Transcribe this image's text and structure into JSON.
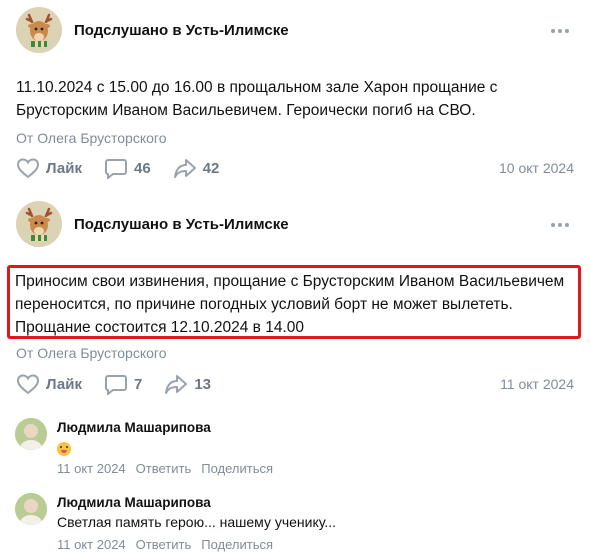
{
  "posts": [
    {
      "group_name": "Подслушано в Усть-Илимске",
      "text": "11.10.2024 с 15.00 до 16.00 в прощальном зале Харон прощание с Брусторским Иваном Васильевичем. Героически погиб на СВО.",
      "author": "От Олега Брусторского",
      "like_label": "Лайк",
      "comments_count": "46",
      "shares_count": "42",
      "date": "10 окт 2024"
    },
    {
      "group_name": "Подслушано в Усть-Илимске",
      "text": "Приносим свои извинения, прощание с Брусторским Иваном Васильевичем переносится, по причине погодных условий борт не может вылететь. Прощание состоится 12.10.2024 в 14.00",
      "author": "От Олега Брусторского",
      "like_label": "Лайк",
      "comments_count": "7",
      "shares_count": "13",
      "date": "11 окт 2024"
    }
  ],
  "comments": [
    {
      "name": "Людмила Машарипова",
      "text": "",
      "emoji": "smiling-face-with-tongue",
      "date": "11 окт 2024",
      "reply_label": "Ответить",
      "share_label": "Поделиться"
    },
    {
      "name": "Людмила Машарипова",
      "text": "Светлая память герою... нашему ученику...",
      "date": "11 окт 2024",
      "reply_label": "Ответить",
      "share_label": "Поделиться"
    }
  ],
  "icons": {
    "more": "more-horizontal-icon",
    "like": "heart-icon",
    "comment": "comment-bubble-icon",
    "share": "share-arrow-icon"
  },
  "colors": {
    "highlight_border": "#e3161c",
    "muted_text": "#818c99",
    "icon_gray": "#99a2ad"
  }
}
